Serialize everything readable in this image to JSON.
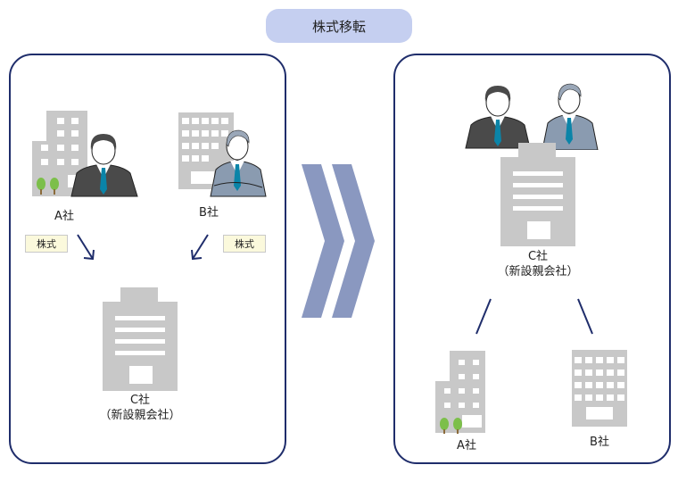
{
  "header": {
    "title": "株式移転"
  },
  "before": {
    "company_a": {
      "label": "A社",
      "share_badge": "株式"
    },
    "company_b": {
      "label": "B社",
      "share_badge": "株式"
    },
    "company_c": {
      "label": "C社",
      "sublabel": "（新設親会社）"
    }
  },
  "transition": {
    "icon": "double-chevron-right-icon"
  },
  "after": {
    "company_c": {
      "label": "C社",
      "sublabel": "（新設親会社）"
    },
    "company_a": {
      "label": "A社"
    },
    "company_b": {
      "label": "B社"
    }
  },
  "colors": {
    "panel_border": "#1f2d6b",
    "title_bg": "#c5cff0",
    "chevron": "#8a98c0",
    "building": "#c8c8c8",
    "badge_bg": "#fbf9dc",
    "arrow": "#1f2d6b",
    "tie": "#0a84a8",
    "tree": "#7cbf4a"
  }
}
